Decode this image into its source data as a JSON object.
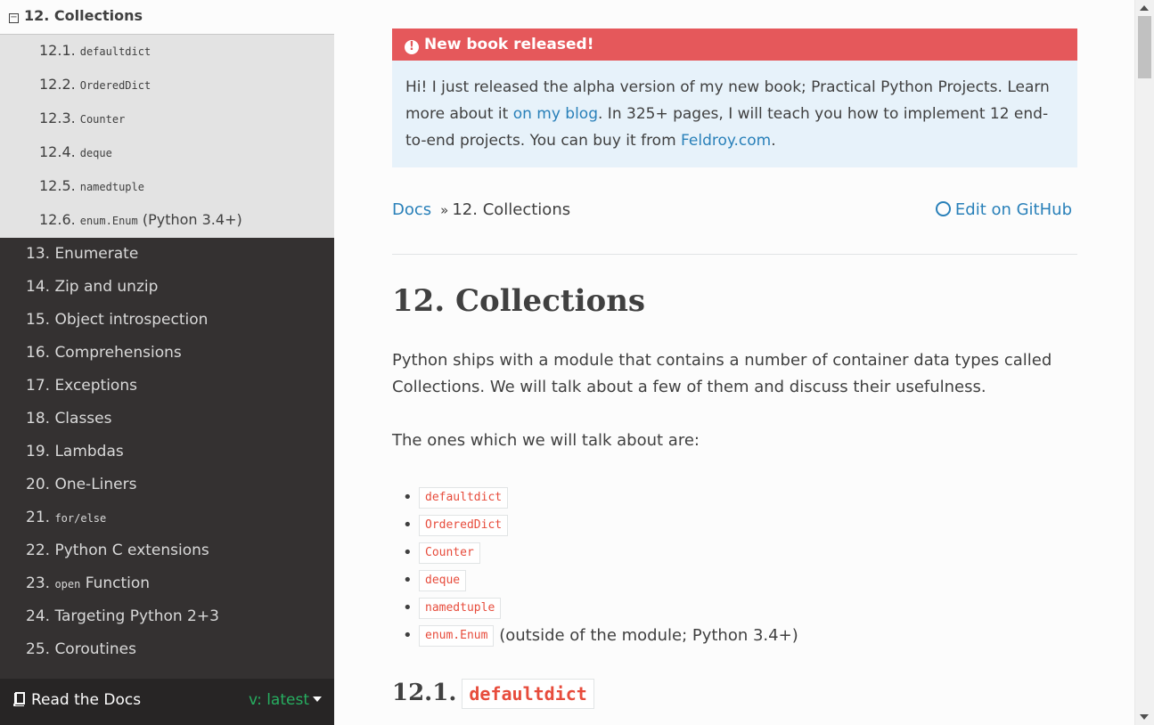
{
  "sidebar": {
    "current": {
      "label": "12. Collections"
    },
    "subitems": [
      {
        "num": "12.1.",
        "code": "defaultdict",
        "suffix": ""
      },
      {
        "num": "12.2.",
        "code": "OrderedDict",
        "suffix": ""
      },
      {
        "num": "12.3.",
        "code": "Counter",
        "suffix": ""
      },
      {
        "num": "12.4.",
        "code": "deque",
        "suffix": ""
      },
      {
        "num": "12.5.",
        "code": "namedtuple",
        "suffix": ""
      },
      {
        "num": "12.6.",
        "code": "enum.Enum",
        "suffix": " (Python 3.4+)"
      }
    ],
    "items": [
      {
        "label": "13. Enumerate"
      },
      {
        "label": "14. Zip and unzip"
      },
      {
        "label": "15. Object introspection"
      },
      {
        "label": "16. Comprehensions"
      },
      {
        "label": "17. Exceptions"
      },
      {
        "label": "18. Classes"
      },
      {
        "label": "19. Lambdas"
      },
      {
        "label": "20. One-Liners"
      },
      {
        "pre": "21.",
        "code": "for/else",
        "post": ""
      },
      {
        "label": "22. Python C extensions"
      },
      {
        "pre": "23.",
        "code": "open",
        "post": "Function"
      },
      {
        "label": "24. Targeting Python 2+3"
      },
      {
        "label": "25. Coroutines"
      }
    ],
    "footer": {
      "brand": "Read the Docs",
      "version": "v: latest"
    }
  },
  "admonition": {
    "title": "New book released!",
    "text1": "Hi! I just released the alpha version of my new book; Practical Python Projects. Learn more about it ",
    "link1": "on my blog",
    "text2": ". In 325+ pages, I will teach you how to implement 12 end-to-end projects. You can buy it from ",
    "link2": "Feldroy.com",
    "text3": "."
  },
  "breadcrumbs": {
    "docs": "Docs",
    "sep": "»",
    "current": "12. Collections",
    "edit": "Edit on GitHub"
  },
  "page": {
    "title": "12. Collections",
    "intro": "Python ships with a module that contains a number of container data types called Collections. We will talk about a few of them and discuss their usefulness.",
    "lead": "The ones which we will talk about are:",
    "bullets": [
      {
        "code": "defaultdict",
        "text": ""
      },
      {
        "code": "OrderedDict",
        "text": ""
      },
      {
        "code": "Counter",
        "text": ""
      },
      {
        "code": "deque",
        "text": ""
      },
      {
        "code": "namedtuple",
        "text": ""
      },
      {
        "code": "enum.Enum",
        "text": "(outside of the module; Python 3.4+)"
      }
    ],
    "section": {
      "num": "12.1.",
      "code": "defaultdict"
    }
  },
  "colors": {
    "sidebar_bg": "#343131",
    "accent": "#2980b9",
    "alert": "#e5585b",
    "code": "#e74c3c",
    "version": "#27ae60"
  }
}
